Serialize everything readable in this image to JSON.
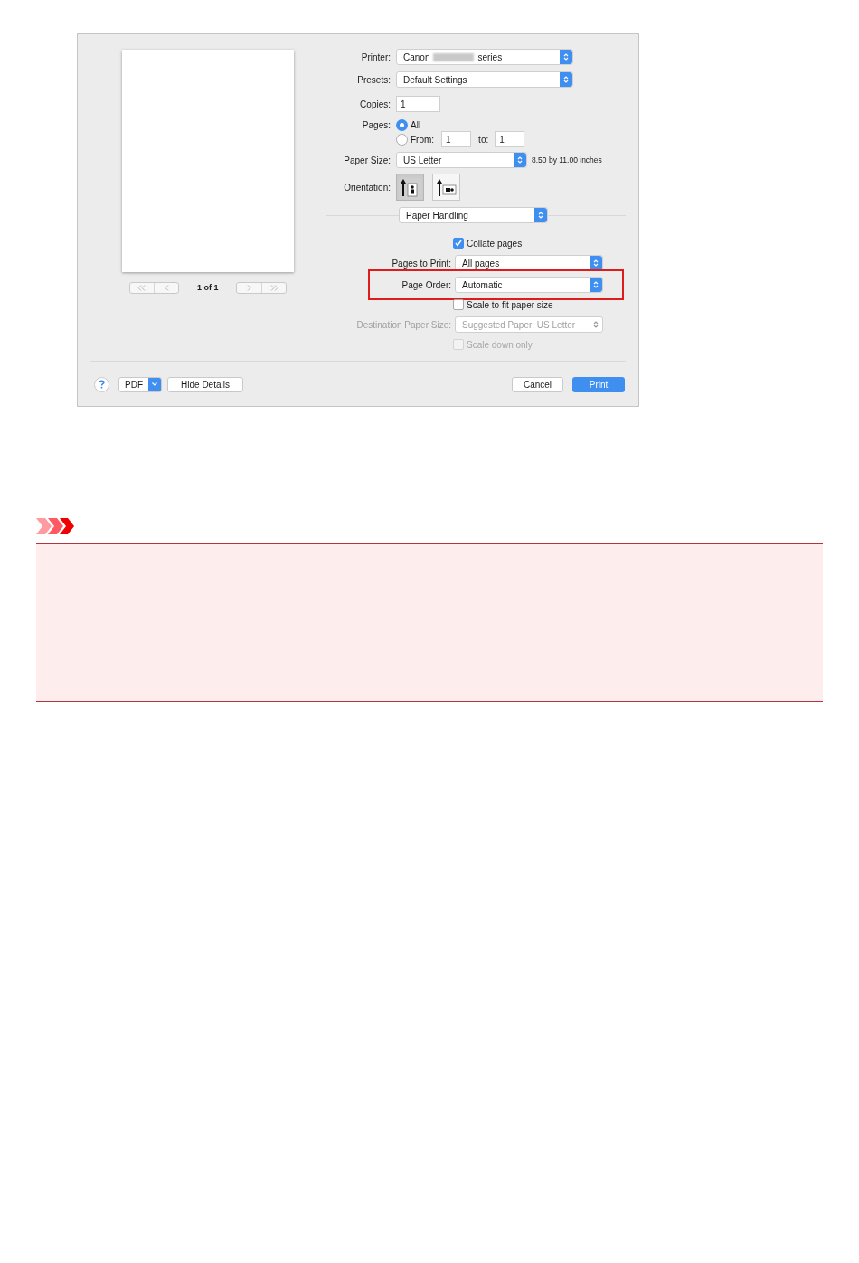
{
  "preview": {
    "page_label": "1 of 1"
  },
  "printer": {
    "label": "Printer:",
    "value_before": "Canon",
    "value_after": "series",
    "redacted": true
  },
  "presets": {
    "label": "Presets:",
    "value": "Default Settings"
  },
  "copies": {
    "label": "Copies:",
    "value": "1"
  },
  "pages": {
    "label": "Pages:",
    "options": [
      {
        "label": "All",
        "selected": true
      },
      {
        "label": "From:",
        "selected": false
      }
    ],
    "from": "1",
    "to_label": "to:",
    "to": "1"
  },
  "paper_size": {
    "label": "Paper Size:",
    "value": "US Letter",
    "dimensions": "8.50 by 11.00 inches"
  },
  "orientation": {
    "label": "Orientation:",
    "options": [
      {
        "kind": "portrait",
        "selected": true
      },
      {
        "kind": "landscape",
        "selected": false
      }
    ]
  },
  "section_menu": {
    "value": "Paper Handling"
  },
  "paper_handling": [
    {
      "kind": "checkbox",
      "label": "Collate pages",
      "checked": true,
      "disabled": false
    },
    {
      "kind": "popup",
      "label": "Pages to Print:",
      "value": "All pages",
      "disabled": false,
      "highlighted": false
    },
    {
      "kind": "popup",
      "label": "Page Order:",
      "value": "Automatic",
      "disabled": false,
      "highlighted": true
    },
    {
      "kind": "checkbox",
      "label": "Scale to fit paper size",
      "checked": false,
      "disabled": false
    },
    {
      "kind": "popup",
      "label": "Destination Paper Size:",
      "value": "Suggested Paper: US Letter",
      "disabled": true,
      "highlighted": false
    },
    {
      "kind": "checkbox",
      "label": "Scale down only",
      "checked": false,
      "disabled": true
    }
  ],
  "footer": {
    "pdf": "PDF",
    "details": "Hide Details",
    "cancel": "Cancel",
    "print": "Print"
  }
}
